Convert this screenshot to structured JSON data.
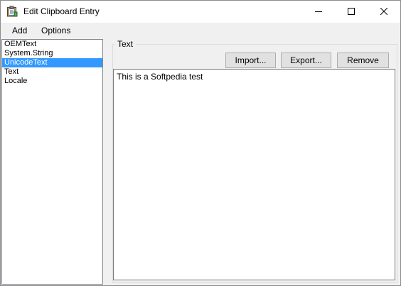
{
  "window": {
    "title": "Edit Clipboard Entry",
    "icon": "clipboard-app-icon",
    "controls": {
      "minimize_icon": "minimize-icon",
      "maximize_icon": "maximize-icon",
      "close_icon": "close-icon"
    }
  },
  "menu": {
    "add_label": "Add",
    "options_label": "Options"
  },
  "formats": {
    "items": [
      {
        "label": "OEMText"
      },
      {
        "label": "System.String"
      },
      {
        "label": "UnicodeText"
      },
      {
        "label": "Text"
      },
      {
        "label": "Locale"
      }
    ],
    "selected_label": "UnicodeText"
  },
  "content": {
    "group_title": "Text",
    "import_label": "Import...",
    "export_label": "Export...",
    "remove_label": "Remove",
    "text_value": "This is a Softpedia test"
  },
  "colors": {
    "selection": "#3399ff",
    "window_bg": "#f0f0f0",
    "titlebar_bg": "#ffffff"
  }
}
